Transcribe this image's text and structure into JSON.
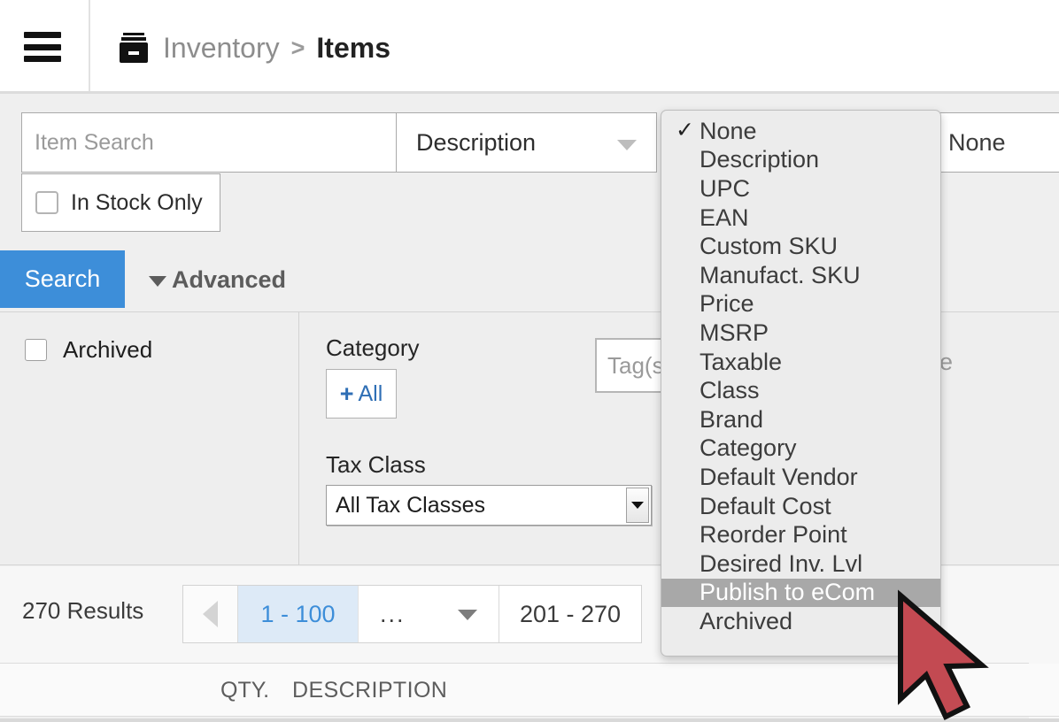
{
  "header": {
    "menu_icon": "hamburger-icon",
    "app_icon": "inventory-box-icon",
    "breadcrumb_parent": "Inventory",
    "breadcrumb_separator": ">",
    "breadcrumb_current": "Items"
  },
  "search": {
    "item_search_placeholder": "Item Search",
    "item_search_value": "",
    "field_select_value": "Description",
    "right_select_value": "None",
    "in_stock_label": "In Stock Only",
    "in_stock_checked": false,
    "search_button": "Search",
    "advanced_button": "Advanced"
  },
  "filters": {
    "archived_label": "Archived",
    "archived_checked": false,
    "category_label": "Category",
    "category_all_button": "All",
    "category_all_plus": "+",
    "tax_class_label": "Tax Class",
    "tax_class_value": "All Tax Classes",
    "tags_placeholder": "Tag(s)",
    "tags_value": "",
    "code_text": "de"
  },
  "pagination": {
    "results_label": "270 Results",
    "prev_icon": "triangle-left-icon",
    "current_page": "1 - 100",
    "ellipsis": "...",
    "dropdown_icon": "chevron-down-icon",
    "last_page": "201 - 270"
  },
  "table": {
    "col_qty": "QTY.",
    "col_description": "DESCRIPTION"
  },
  "dropdown": {
    "checked_index": 0,
    "highlighted_index": 16,
    "items": [
      "None",
      "Description",
      "UPC",
      "EAN",
      "Custom SKU",
      "Manufact. SKU",
      "Price",
      "MSRP",
      "Taxable",
      "Class",
      "Brand",
      "Category",
      "Default Vendor",
      "Default Cost",
      "Reorder Point",
      "Desired Inv. Lvl",
      "Publish to eCom",
      "Archived"
    ]
  },
  "cursor": {
    "icon": "mouse-pointer-icon",
    "fill": "#c34a52",
    "stroke": "#111111"
  },
  "colors": {
    "accent_blue": "#3d8ed9",
    "page_bg": "#efefef",
    "menu_bg": "#ececec",
    "menu_highlight": "#a8a8a8"
  }
}
